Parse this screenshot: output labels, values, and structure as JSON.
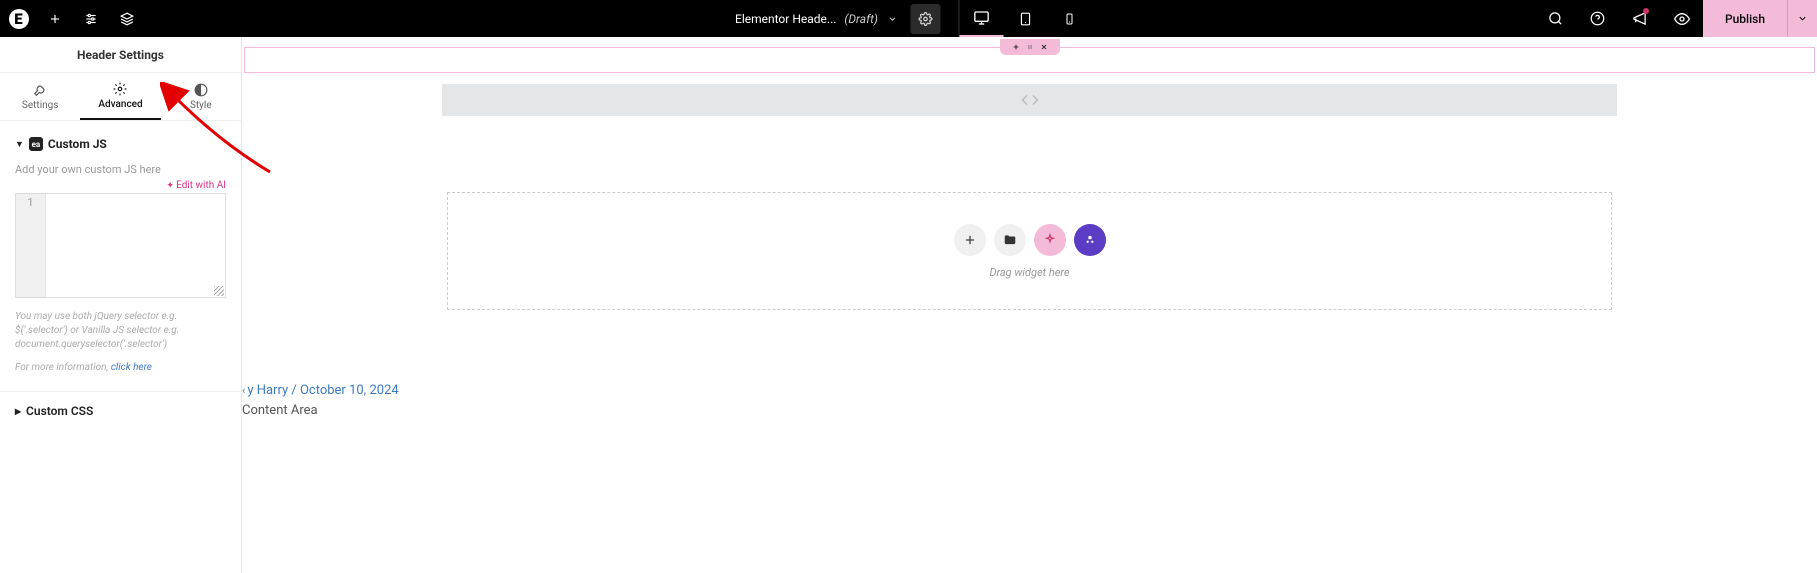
{
  "topbar": {
    "doc_title": "Elementor Heade...",
    "doc_status": "(Draft)",
    "publish_label": "Publish"
  },
  "sidebar": {
    "header_title": "Header Settings",
    "tabs": {
      "settings": "Settings",
      "advanced": "Advanced",
      "style": "Style"
    },
    "custom_js": {
      "title": "Custom JS",
      "help": "Add your own custom JS here",
      "edit_ai": "Edit with AI",
      "line_number": "1",
      "hint": "You may use both jQuery selector e.g. $('.selector') or Vanilla JS selector e.g. document.queryselector('.selector')",
      "hint2_prefix": "For more information, ",
      "hint2_link": "click here"
    },
    "custom_css": {
      "title": "Custom CSS"
    }
  },
  "canvas": {
    "drag_text": "Drag widget here",
    "meta_author_prefix": "y ",
    "meta_author": "Harry",
    "meta_sep": " / ",
    "meta_date": "October 10, 2024",
    "content_area": "Content Area"
  }
}
